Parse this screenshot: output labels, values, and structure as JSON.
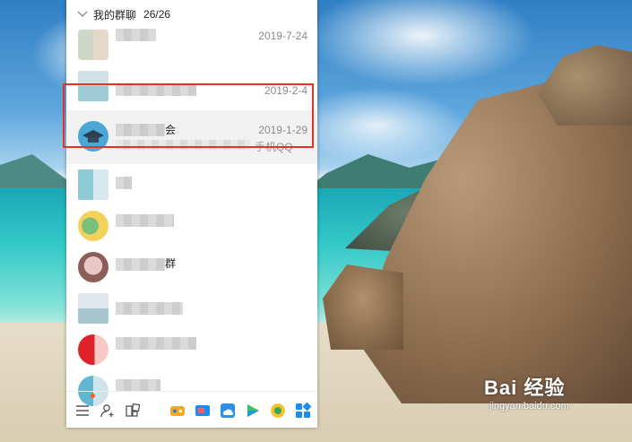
{
  "group_header": {
    "title": "我的群聊",
    "count": "26/26"
  },
  "contacts": [
    {
      "name_tail": "",
      "message_tail": "",
      "date": "2019-7-24"
    },
    {
      "name_tail": "",
      "message_tail": "",
      "date": "2019-2-4"
    },
    {
      "name_tail": "会",
      "message_tail": "手机QQ",
      "date": "2019-1-29"
    },
    {
      "name_tail": "",
      "message_tail": "",
      "date": ""
    },
    {
      "name_tail": "",
      "message_tail": "",
      "date": ""
    },
    {
      "name_tail": "群",
      "message_tail": "",
      "date": ""
    },
    {
      "name_tail": "",
      "message_tail": "",
      "date": ""
    },
    {
      "name_tail": "",
      "message_tail": "",
      "date": ""
    },
    {
      "name_tail": "",
      "message_tail": "",
      "date": ""
    }
  ],
  "toolbar": {
    "icons": [
      "menu-icon",
      "add-contact-icon",
      "app-manager-icon",
      "game-icon",
      "video-icon",
      "weather-icon",
      "play-icon",
      "wallet-icon",
      "apps-grid-icon"
    ]
  },
  "watermark": {
    "logo": "Bai 经验",
    "url": "jingyan.baidu.com"
  },
  "colors": {
    "highlight": "#e23326",
    "notification_dot": "#ff5a1f"
  }
}
